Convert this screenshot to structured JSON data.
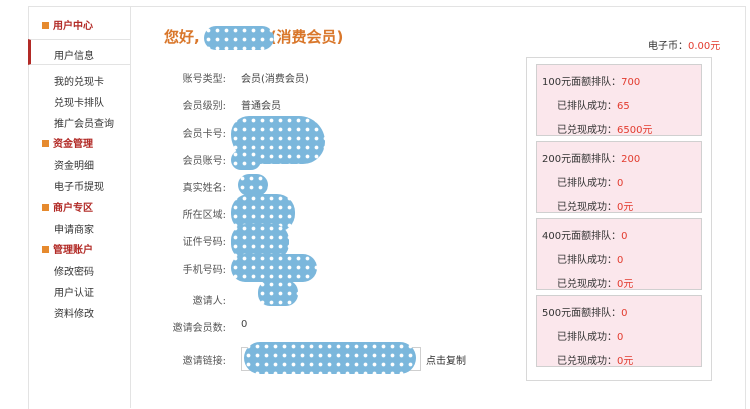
{
  "sidebar": {
    "groups": [
      {
        "title": "用户中心",
        "items": [
          "用户信息",
          "我的兑现卡",
          "兑现卡排队",
          "推广会员查询"
        ]
      },
      {
        "title": "资金管理",
        "items": [
          "资金明细",
          "电子币提现"
        ]
      },
      {
        "title": "商户专区",
        "items": [
          "申请商家"
        ]
      },
      {
        "title": "管理账户",
        "items": [
          "修改密码",
          "用户认证",
          "资料修改"
        ]
      }
    ],
    "active_item": "用户信息"
  },
  "header": {
    "greeting_prefix": "您好,",
    "greeting_suffix": "(消费会员)",
    "ecoin_label": "电子币：",
    "ecoin_value": "0.00元"
  },
  "info": {
    "rows": [
      {
        "label": "账号类型:",
        "value": "会员(消费会员)"
      },
      {
        "label": "会员级别:",
        "value": "普通会员"
      },
      {
        "label": "会员卡号:",
        "value": ""
      },
      {
        "label": "会员账号:",
        "value": ""
      },
      {
        "label": "真实姓名:",
        "value": ""
      },
      {
        "label": "所在区域:",
        "value": ""
      },
      {
        "label": "证件号码:",
        "value": ""
      },
      {
        "label": "手机号码:",
        "value": ""
      },
      {
        "label": "邀请人:",
        "value": ""
      },
      {
        "label": "邀请会员数:",
        "value": "0"
      }
    ],
    "invite_link_label": "邀请链接:",
    "copy_label": "点击复制"
  },
  "queue_cards": [
    {
      "title": "100元面额排队：",
      "title_value": "700",
      "queued_label": "已排队成功：",
      "queued_value": "65",
      "cashed_label": "已兑现成功：",
      "cashed_value": "6500元"
    },
    {
      "title": "200元面额排队：",
      "title_value": "200",
      "queued_label": "已排队成功：",
      "queued_value": "0",
      "cashed_label": "已兑现成功：",
      "cashed_value": "0元"
    },
    {
      "title": "400元面额排队：",
      "title_value": "0",
      "queued_label": "已排队成功：",
      "queued_value": "0",
      "cashed_label": "已兑现成功：",
      "cashed_value": "0元"
    },
    {
      "title": "500元面额排队：",
      "title_value": "0",
      "queued_label": "已排队成功：",
      "queued_value": "0",
      "cashed_label": "已兑现成功：",
      "cashed_value": "0元"
    }
  ],
  "colors": {
    "accent_red": "#b22a26",
    "greeting_orange": "#d9772b",
    "value_red": "#e23b2e",
    "card_pink": "#fbe7ec",
    "mask_blue": "#7bb7dc"
  }
}
